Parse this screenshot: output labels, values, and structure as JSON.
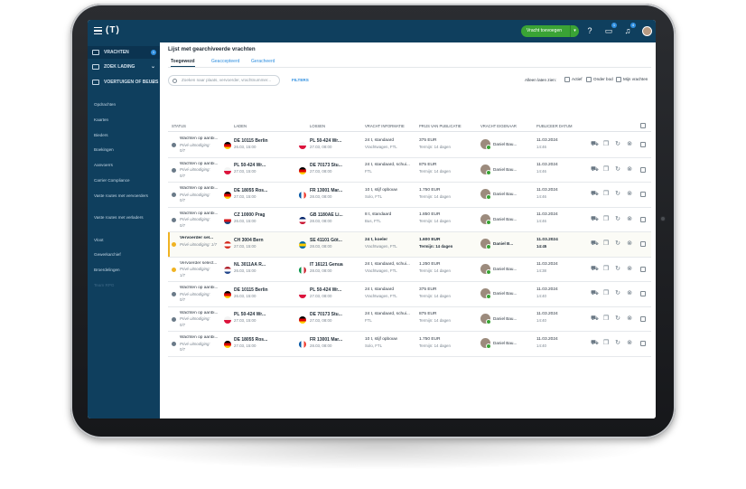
{
  "app": {
    "logo": "(T)",
    "offer_button": "Vracht toevoegen",
    "notif_count_chat": "1",
    "notif_count_bell": "4"
  },
  "sidebar": {
    "main_items": [
      {
        "label": "VRACHTEN",
        "badge": "1"
      },
      {
        "label": "ZOEK LADING"
      },
      {
        "label": "VOERTUIGEN OF BEURS"
      }
    ],
    "sub_items": [
      "Opdrachten",
      "Kaarten",
      "Bieders",
      "Boekingen",
      "Aanvoerrs",
      "Carrier Compliance",
      "Vaste routes met vervoerders",
      "Vaste routes met verladers",
      "Vloot",
      "Gewerkarchief",
      "Broerdelingen",
      "Team RPG"
    ]
  },
  "page": {
    "title": "Lijst met gearchiveerde vrachten",
    "tabs": [
      "Toegewezd",
      "Geaccepteerd",
      "Geracheerd"
    ],
    "search_placeholder": "Zoeken naar plaats, vervoerder, vrachtnummer...",
    "filters_label": "FILTERS",
    "only_show_label": "Alleen laten zien:",
    "options": [
      "Actief",
      "Onder bod",
      "Mijn vrachten"
    ]
  },
  "table": {
    "headers": [
      "STATUS",
      "LADEN",
      "LOSSEN",
      "VRACHT INFORMATIE",
      "PRIJS VAN PUBLICATIE",
      "VRACHT EIGENAAR",
      "PUBLICEER DATUM"
    ],
    "rows": [
      {
        "status1": "Wachten op aanbi...",
        "status2": "Privé uitnodiging:",
        "status3": "0/7",
        "load": "DE 10115 Berlin",
        "load_date": "26.03, 15:00",
        "unload": "PL 50-424 Wr...",
        "unload_date": "27.03, 08:00",
        "info1": "24 t, standaard",
        "info2": "Vrachtwagen, FTL",
        "price": "375 EUR",
        "term": "Termijn: 14 dagen",
        "owner": "Daniel Bau...",
        "pub_date": "11.03.2024",
        "pub_time": "14:46",
        "highlight": false,
        "bold": false
      },
      {
        "status1": "Wachten op aanbi...",
        "status2": "Privé uitnodiging:",
        "status3": "0/7",
        "load": "PL 50-424 Wr...",
        "load_date": "27.03, 15:00",
        "unload": "DE 70173 Stu...",
        "unload_date": "27.03, 08:00",
        "info1": "24 t, standaard, schui...",
        "info2": "FTL",
        "price": "875 EUR",
        "term": "Termijn: 14 dagen",
        "owner": "Daniel Bau...",
        "pub_date": "11.03.2024",
        "pub_time": "14:46",
        "highlight": false,
        "bold": false
      },
      {
        "status1": "Wachten op aanbi...",
        "status2": "Privé uitnodiging:",
        "status3": "0/7",
        "load": "DE 18055 Ros...",
        "load_date": "27.03, 15:00",
        "unload": "FR 13001 Mar...",
        "unload_date": "28.03, 08:00",
        "info1": "10 t, stijf opbouw",
        "info2": "Solo, FTL",
        "price": "1.750 EUR",
        "term": "Termijn: 14 dagen",
        "owner": "Daniel Bau...",
        "pub_date": "11.03.2024",
        "pub_time": "14:46",
        "highlight": false,
        "bold": false
      },
      {
        "status1": "Wachten op aanbi...",
        "status2": "Privé uitnodiging:",
        "status3": "0/7",
        "load": "CZ 10000 Prag",
        "load_date": "26.03, 15:00",
        "unload": "GB 1180AE Li...",
        "unload_date": "28.03, 08:00",
        "info1": "8 t, standaard",
        "info2": "Bus, FTL",
        "price": "1.850 EUR",
        "term": "Termijn: 14 dagen",
        "owner": "Daniel Bau...",
        "pub_date": "11.03.2024",
        "pub_time": "14:46",
        "highlight": false,
        "bold": false
      },
      {
        "status1": "Vervoerder sel...",
        "status2": "Privé uitnodiging: 1/7",
        "status3": "",
        "load": "CH 3004 Bern",
        "load_date": "27.03, 15:00",
        "unload": "SE 41101 Göt...",
        "unload_date": "28.03, 08:00",
        "info1": "24 t, koeler",
        "info2": "Vrachtwagen, FTL",
        "price": "1.600 EUR",
        "term": "Termijn: 14 dagen",
        "owner": "Daniel B...",
        "pub_date": "11.03.2024",
        "pub_time": "14:45",
        "highlight": true,
        "bold": true
      },
      {
        "status1": "Vervoerder select...",
        "status2": "Privé uitnodiging:",
        "status3": "1/7",
        "load": "NL 3011AA R...",
        "load_date": "26.03, 15:00",
        "unload": "IT 16121 Genua",
        "unload_date": "28.03, 08:00",
        "info1": "24 t, standaard, schui...",
        "info2": "Vrachtwagen, FTL",
        "price": "1.250 EUR",
        "term": "Termijn: 14 dagen",
        "owner": "Daniel Bau...",
        "pub_date": "11.03.2024",
        "pub_time": "14:38",
        "highlight": false,
        "bold": false
      },
      {
        "status1": "Wachten op aanbi...",
        "status2": "Privé uitnodiging:",
        "status3": "0/7",
        "load": "DE 10115 Berlin",
        "load_date": "26.03, 15:00",
        "unload": "PL 50-424 Wr...",
        "unload_date": "27.03, 08:00",
        "info1": "24 t, standaard",
        "info2": "Vrachtwagen, FTL",
        "price": "375 EUR",
        "term": "Termijn: 14 dagen",
        "owner": "Daniel Bau...",
        "pub_date": "11.03.2024",
        "pub_time": "14:40",
        "highlight": false,
        "bold": false
      },
      {
        "status1": "Wachten op aanbi...",
        "status2": "Privé uitnodiging:",
        "status3": "0/7",
        "load": "PL 50-424 Wr...",
        "load_date": "27.03, 15:00",
        "unload": "DE 70173 Stu...",
        "unload_date": "27.03, 08:00",
        "info1": "24 t, standaard, schui...",
        "info2": "FTL",
        "price": "875 EUR",
        "term": "Termijn: 14 dagen",
        "owner": "Daniel Bau...",
        "pub_date": "11.03.2024",
        "pub_time": "14:40",
        "highlight": false,
        "bold": false
      },
      {
        "status1": "Wachten op aanbi...",
        "status2": "Privé uitnodiging:",
        "status3": "0/7",
        "load": "DE 18055 Ros...",
        "load_date": "27.03, 15:00",
        "unload": "FR 13001 Mar...",
        "unload_date": "28.03, 08:00",
        "info1": "10 t, stijf opbouw",
        "info2": "Solo, FTL",
        "price": "1.750 EUR",
        "term": "Termijn: 14 dagen",
        "owner": "Daniel Bau...",
        "pub_date": "11.03.2024",
        "pub_time": "14:40",
        "highlight": false,
        "bold": false
      }
    ]
  },
  "colors": {
    "sidebar": "#0f3f5e",
    "accent": "#2f8fe0",
    "offer_button": "#3aa335",
    "highlight": "#f0b323"
  }
}
